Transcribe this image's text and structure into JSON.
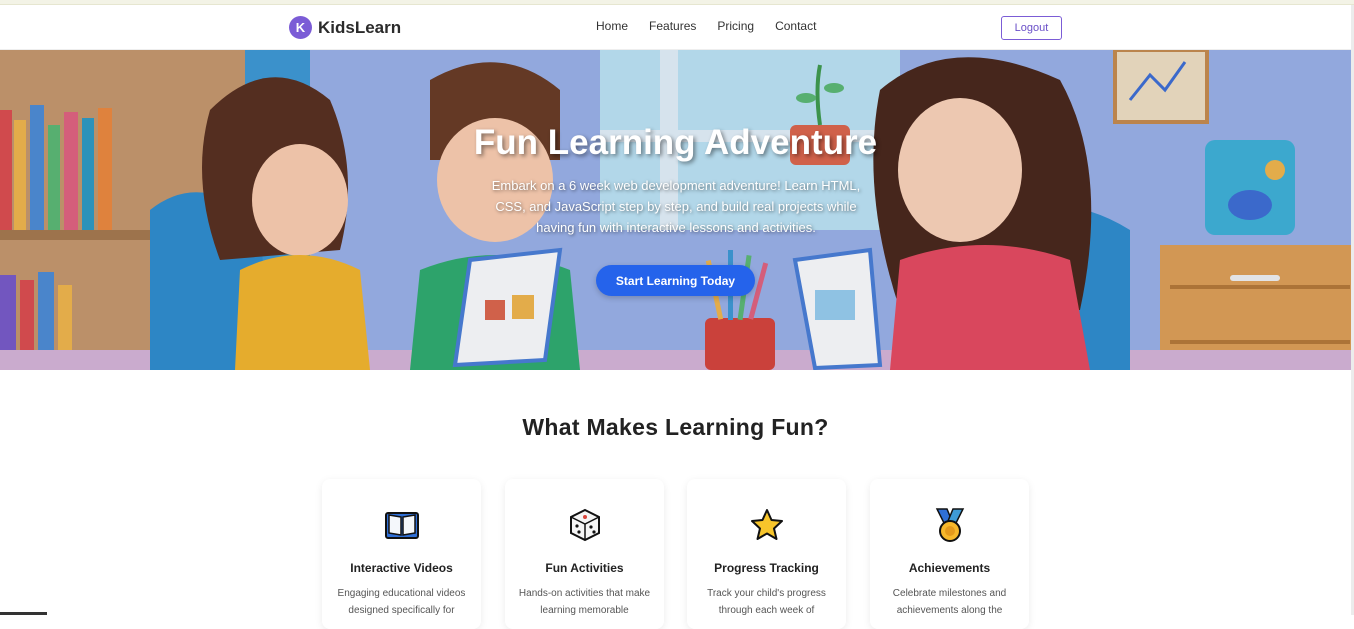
{
  "nav": {
    "brand_initial": "K",
    "brand_name": "KidsLearn",
    "links": [
      "Home",
      "Features",
      "Pricing",
      "Contact"
    ],
    "logout_label": "Logout"
  },
  "hero": {
    "title": "Fun Learning Adventure",
    "subtitle": "Embark on a 6 week web development adventure! Learn HTML, CSS, and JavaScript step by step, and build real projects while having fun with interactive lessons and activities.",
    "cta_label": "Start Learning Today"
  },
  "features": {
    "title": "What Makes Learning Fun?",
    "cards": [
      {
        "icon": "book-icon",
        "title": "Interactive Videos",
        "desc": "Engaging educational videos designed specifically for"
      },
      {
        "icon": "dice-icon",
        "title": "Fun Activities",
        "desc": "Hands-on activities that make learning memorable"
      },
      {
        "icon": "star-icon",
        "title": "Progress Tracking",
        "desc": "Track your child's progress through each week of"
      },
      {
        "icon": "medal-icon",
        "title": "Achievements",
        "desc": "Celebrate milestones and achievements along the"
      }
    ]
  },
  "colors": {
    "brand": "#7b5cd6",
    "cta": "#2563eb"
  }
}
